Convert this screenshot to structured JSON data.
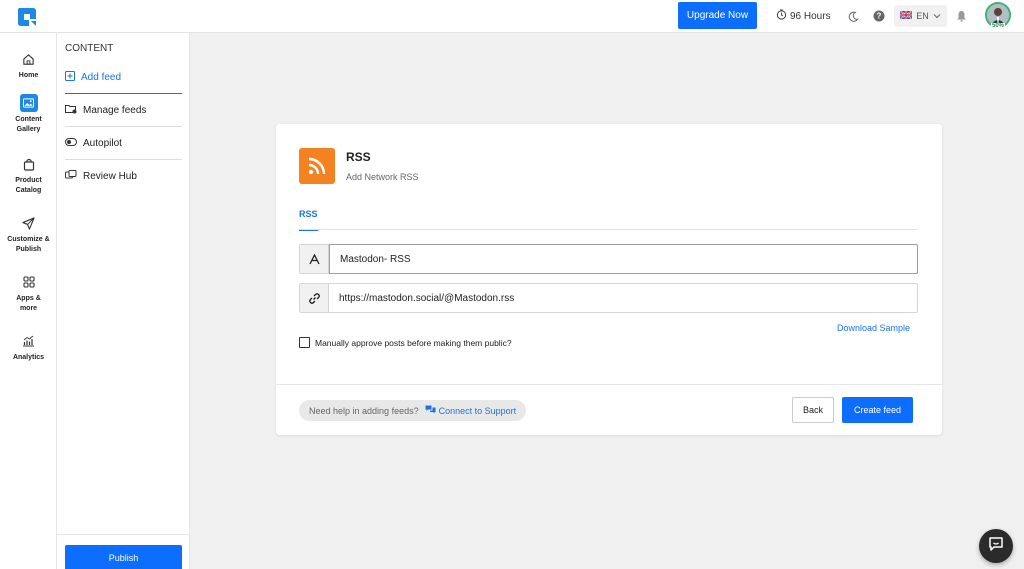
{
  "topbar": {
    "upgrade_label": "Upgrade Now",
    "hours_label": "96 Hours",
    "language": "EN",
    "profile_percent": "50%"
  },
  "rail": {
    "items": [
      {
        "label": "Home",
        "icon": "home-icon"
      },
      {
        "label": "Content Gallery",
        "icon": "gallery-icon",
        "active": true
      },
      {
        "label": "Product Catalog",
        "icon": "bag-icon"
      },
      {
        "label": "Customize & Publish",
        "icon": "send-icon"
      },
      {
        "label": "Apps & more",
        "icon": "apps-icon"
      },
      {
        "label": "Analytics",
        "icon": "analytics-icon"
      }
    ]
  },
  "sidebar": {
    "title": "CONTENT",
    "items": [
      {
        "label": "Add feed",
        "icon": "plus-square-icon",
        "active": true
      },
      {
        "label": "Manage feeds",
        "icon": "folder-gear-icon"
      },
      {
        "label": "Autopilot",
        "icon": "toggle-icon"
      },
      {
        "label": "Review Hub",
        "icon": "reviews-icon"
      }
    ],
    "publish_label": "Publish"
  },
  "card": {
    "title": "RSS",
    "subtitle": "Add Network RSS",
    "tab_label": "RSS",
    "name_value": "Mastodon- RSS",
    "url_value": "https://mastodon.social/@Mastodon.rss",
    "download_label": "Download Sample",
    "approve_label": "Manually approve posts before making them public?",
    "help_text": "Need help in adding feeds?",
    "support_label": "Connect to Support",
    "back_label": "Back",
    "create_label": "Create feed"
  },
  "colors": {
    "primary": "#0d6efd",
    "link": "#1a73e8",
    "rss_orange": "#f58220"
  }
}
